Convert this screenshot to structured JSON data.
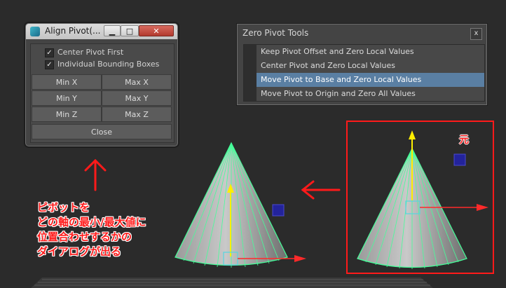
{
  "align_window": {
    "title": "Align Pivot(...",
    "min_symbol": "▁",
    "max_symbol": "□",
    "close_symbol": "✕",
    "options": [
      {
        "label": "Center Pivot First",
        "checked": true
      },
      {
        "label": "Individual Bounding Boxes",
        "checked": true
      }
    ],
    "buttons": {
      "min_x": "Min X",
      "max_x": "Max X",
      "min_y": "Min Y",
      "max_y": "Max Y",
      "min_z": "Min Z",
      "max_z": "Max Z"
    },
    "close_label": "Close"
  },
  "zero_window": {
    "title": "Zero Pivot Tools",
    "close_symbol": "x",
    "items": [
      "Keep Pivot Offset and Zero Local Values",
      "Center Pivot and Zero Local Values",
      "Move Pivot to Base and Zero Local Values",
      "Move Pivot to Origin and Zero All Values"
    ],
    "selected_index": 2
  },
  "annotations": {
    "note_lines": [
      "ピボットを",
      "どの軸の最小/最大値に",
      "位置合わせするかの",
      "ダイアログが出る"
    ],
    "original_label": "元"
  },
  "colors": {
    "annotation_red": "#ff1a1a",
    "selection_blue": "#5a7fa3",
    "wireframe_green": "#44ff99",
    "pivot_cyan": "#55d6e0",
    "y_axis_yellow": "#ffee00"
  }
}
